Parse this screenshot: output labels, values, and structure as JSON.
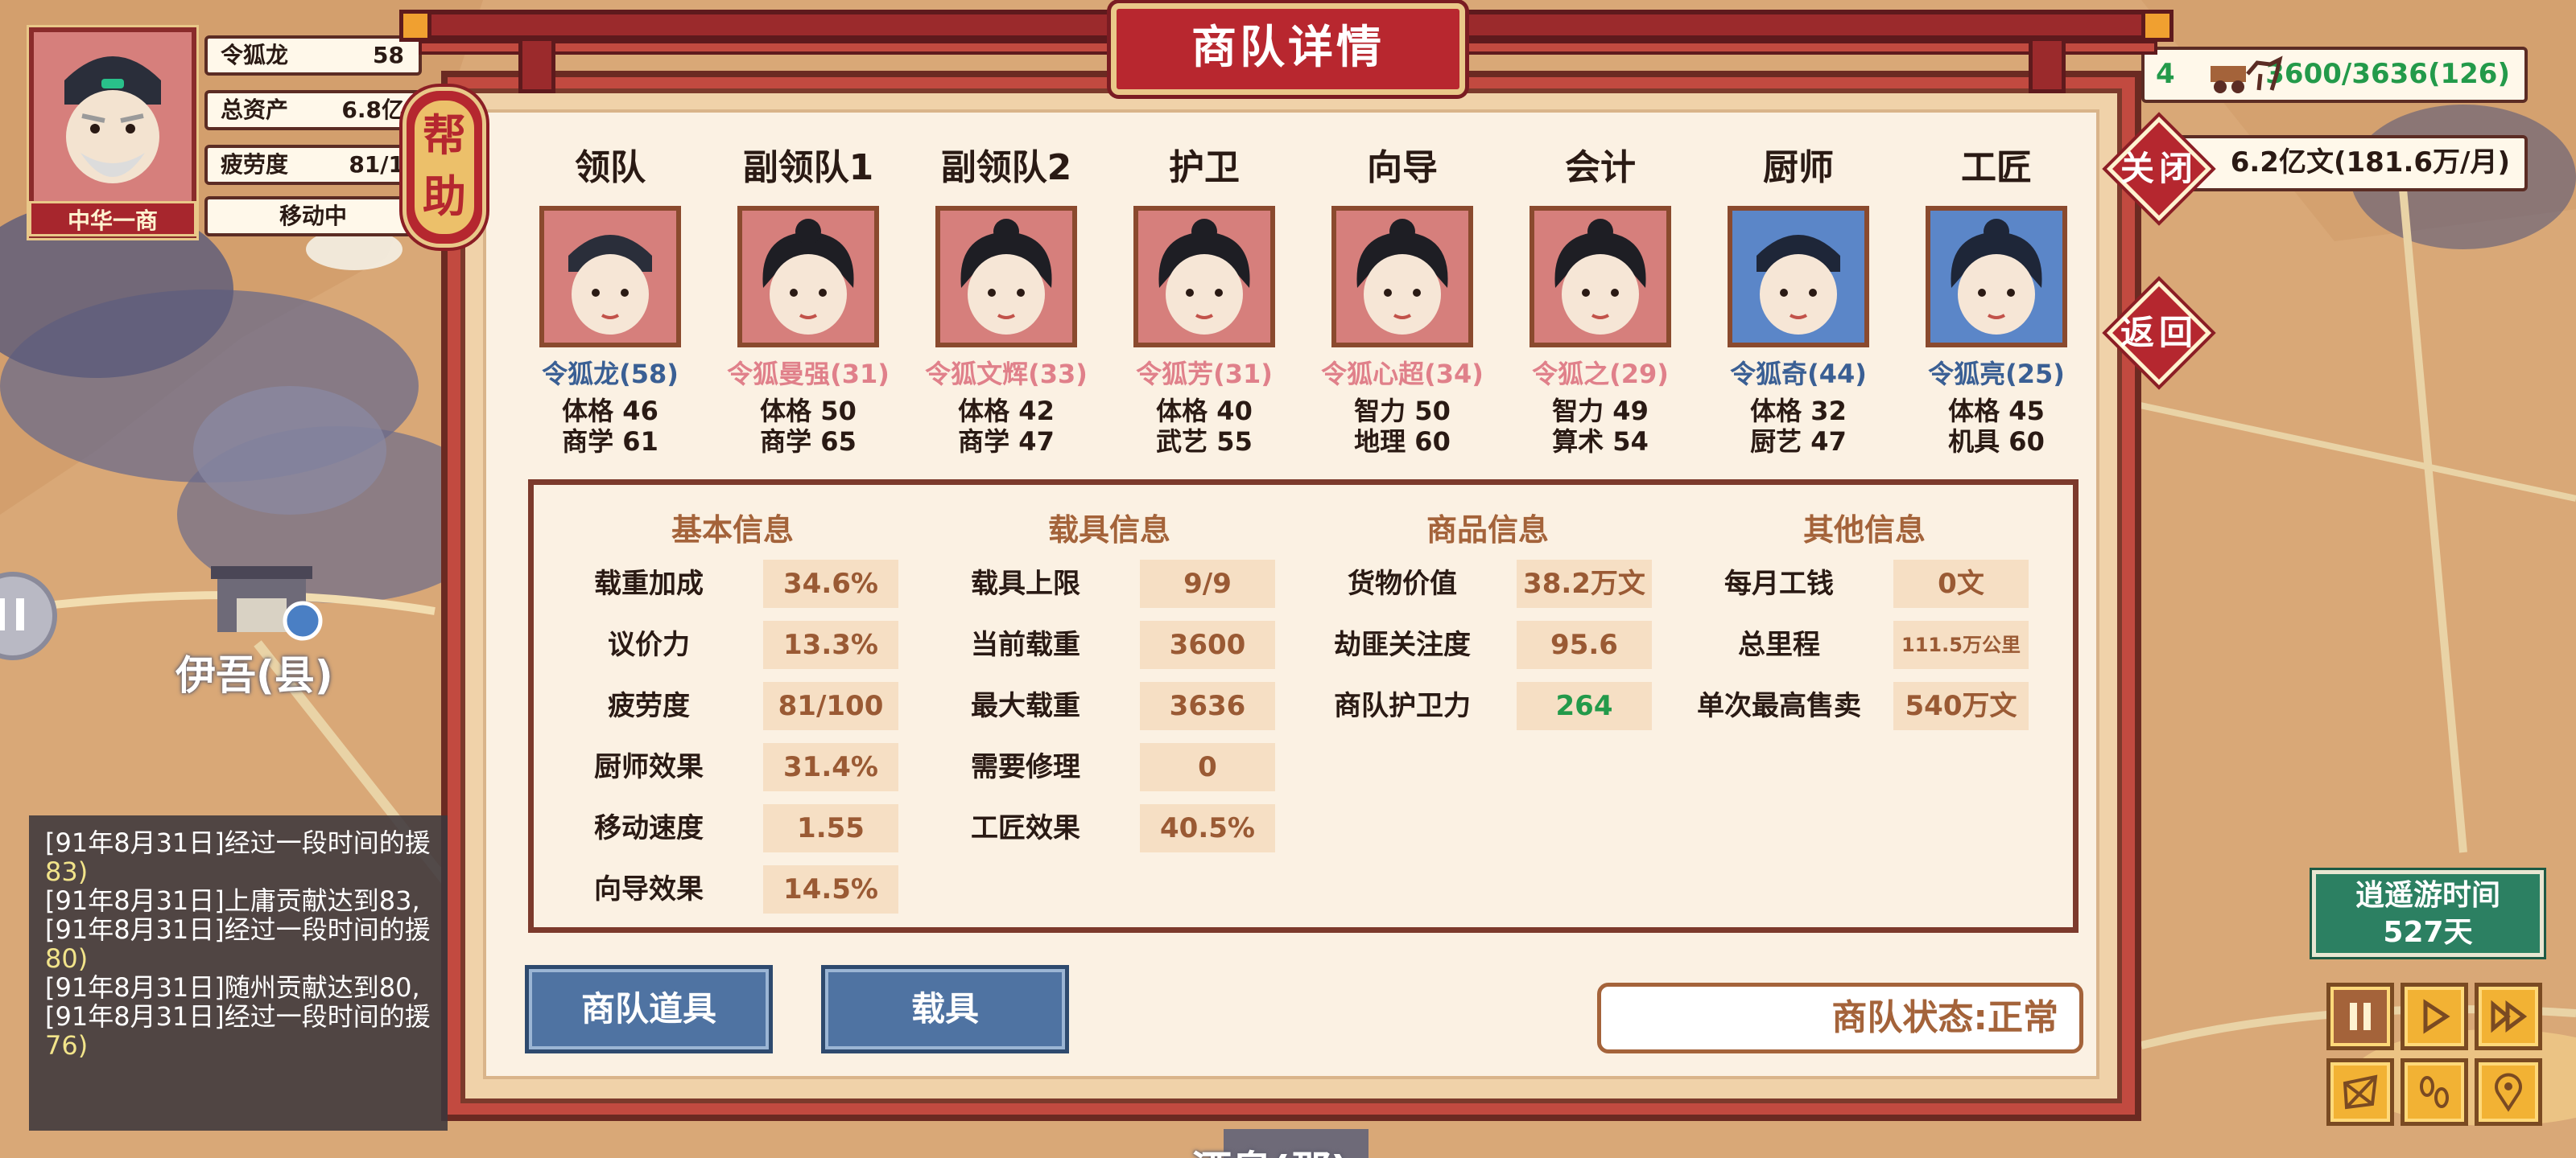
{
  "player": {
    "name": "令狐龙",
    "level": "58",
    "title_plate": "中华一商",
    "stats": [
      {
        "label": "令狐龙",
        "value": "58"
      },
      {
        "label": "总资产",
        "value": "6.8亿"
      },
      {
        "label": "疲劳度",
        "value": "81/1"
      }
    ],
    "move_status": "移动中"
  },
  "resources": {
    "cargo": "3600/3636(126)",
    "cargo_prefix": "4",
    "money": "6.2亿文(181.6万/月)"
  },
  "dialog": {
    "title": "商队详情",
    "help_label": "帮助",
    "help_chars": [
      "帮",
      "助"
    ],
    "close_label": "关闭",
    "back_label": "返回"
  },
  "crew": [
    {
      "role": "领队",
      "name": "令狐龙(58)",
      "stat1": "体格 46",
      "stat2": "商学 61",
      "name_color": "blue"
    },
    {
      "role": "副领队1",
      "name": "令狐曼强(31)",
      "stat1": "体格 50",
      "stat2": "商学 65",
      "name_color": "pink"
    },
    {
      "role": "副领队2",
      "name": "令狐文辉(33)",
      "stat1": "体格 42",
      "stat2": "商学 47",
      "name_color": "pink"
    },
    {
      "role": "护卫",
      "name": "令狐芳(31)",
      "stat1": "体格 40",
      "stat2": "武艺 55",
      "name_color": "pink"
    },
    {
      "role": "向导",
      "name": "令狐心超(34)",
      "stat1": "智力 50",
      "stat2": "地理 60",
      "name_color": "pink"
    },
    {
      "role": "会计",
      "name": "令狐之(29)",
      "stat1": "智力 49",
      "stat2": "算术 54",
      "name_color": "pink"
    },
    {
      "role": "厨师",
      "name": "令狐奇(44)",
      "stat1": "体格 32",
      "stat2": "厨艺 47",
      "name_color": "blue"
    },
    {
      "role": "工匠",
      "name": "令狐亮(25)",
      "stat1": "体格 45",
      "stat2": "机具 60",
      "name_color": "blue"
    }
  ],
  "sections": {
    "basic": {
      "title": "基本信息",
      "rows": [
        {
          "label": "载重加成",
          "value": "34.6%"
        },
        {
          "label": "议价力",
          "value": "13.3%"
        },
        {
          "label": "疲劳度",
          "value": "81/100"
        },
        {
          "label": "厨师效果",
          "value": "31.4%"
        },
        {
          "label": "移动速度",
          "value": "1.55"
        },
        {
          "label": "向导效果",
          "value": "14.5%"
        }
      ]
    },
    "vehicle": {
      "title": "载具信息",
      "rows": [
        {
          "label": "载具上限",
          "value": "9/9"
        },
        {
          "label": "当前载重",
          "value": "3600"
        },
        {
          "label": "最大载重",
          "value": "3636"
        },
        {
          "label": "需要修理",
          "value": "0"
        },
        {
          "label": "工匠效果",
          "value": "40.5%"
        }
      ]
    },
    "goods": {
      "title": "商品信息",
      "rows": [
        {
          "label": "货物价值",
          "value": "38.2万文"
        },
        {
          "label": "劫匪关注度",
          "value": "95.6"
        },
        {
          "label": "商队护卫力",
          "value": "264"
        }
      ]
    },
    "other": {
      "title": "其他信息",
      "rows": [
        {
          "label": "每月工钱",
          "value": "0文"
        },
        {
          "label": "总里程",
          "value": "111.5万公里"
        },
        {
          "label": "单次最高售卖",
          "value": "540万文"
        }
      ]
    }
  },
  "buttons": {
    "items": "商队道具",
    "vehicle": "载具"
  },
  "caravan_status": "商队状态:正常",
  "log": [
    {
      "text": "[91年8月31日]经过一段时间的援"
    },
    {
      "text": "83)",
      "num": true
    },
    {
      "text": "[91年8月31日]上庸贡献达到83,"
    },
    {
      "text": "[91年8月31日]经过一段时间的援"
    },
    {
      "text": "80)",
      "num": true
    },
    {
      "text": "[91年8月31日]随州贡献达到80,"
    },
    {
      "text": "[91年8月31日]经过一段时间的援"
    },
    {
      "text": "76)",
      "num": true
    }
  ],
  "time": {
    "label": "逍遥游时间",
    "days": "527天"
  },
  "map": {
    "town": "伊吾(县)",
    "bottom_partial": "酒泉(郡)"
  },
  "colors": {
    "dialog_red": "#b8272f",
    "accent_brown": "#a4633a",
    "green": "#239a4a",
    "blue_name": "#3a5f94",
    "pink_name": "#e0808a"
  }
}
